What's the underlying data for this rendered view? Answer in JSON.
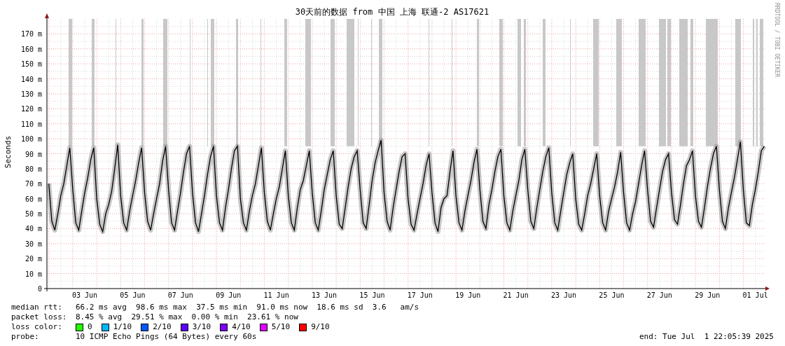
{
  "chart": {
    "title": "30天前的数据 from 中国 上海 联通-2 AS17621",
    "side_note": "RRDTOOL / TOBI OETIKER",
    "chart_data": {
      "type": "line",
      "ylabel": "Seconds",
      "ylim": [
        0,
        180
      ],
      "grid": true,
      "yticks": [
        {
          "value": 0,
          "label": "0"
        },
        {
          "value": 10,
          "label": "10 m"
        },
        {
          "value": 20,
          "label": "20 m"
        },
        {
          "value": 30,
          "label": "30 m"
        },
        {
          "value": 40,
          "label": "40 m"
        },
        {
          "value": 50,
          "label": "50 m"
        },
        {
          "value": 60,
          "label": "60 m"
        },
        {
          "value": 70,
          "label": "70 m"
        },
        {
          "value": 80,
          "label": "80 m"
        },
        {
          "value": 90,
          "label": "90 m"
        },
        {
          "value": 100,
          "label": "100 m"
        },
        {
          "value": 110,
          "label": "110 m"
        },
        {
          "value": 120,
          "label": "120 m"
        },
        {
          "value": 130,
          "label": "130 m"
        },
        {
          "value": 140,
          "label": "140 m"
        },
        {
          "value": 150,
          "label": "150 m"
        },
        {
          "value": 160,
          "label": "160 m"
        },
        {
          "value": 170,
          "label": "170 m"
        }
      ],
      "categories": [
        null,
        null,
        null,
        null,
        null,
        null,
        null,
        null,
        null,
        null,
        null,
        null,
        "03 Jun",
        null,
        null,
        null,
        null,
        null,
        null,
        null,
        null,
        null,
        null,
        null,
        null,
        null,
        null,
        null,
        "05 Jun",
        null,
        null,
        null,
        null,
        null,
        null,
        null,
        null,
        null,
        null,
        null,
        null,
        null,
        null,
        null,
        "07 Jun",
        null,
        null,
        null,
        null,
        null,
        null,
        null,
        null,
        null,
        null,
        null,
        null,
        null,
        null,
        null,
        "09 Jun",
        null,
        null,
        null,
        null,
        null,
        null,
        null,
        null,
        null,
        null,
        null,
        null,
        null,
        null,
        null,
        "11 Jun",
        null,
        null,
        null,
        null,
        null,
        null,
        null,
        null,
        null,
        null,
        null,
        null,
        null,
        null,
        null,
        "13 Jun",
        null,
        null,
        null,
        null,
        null,
        null,
        null,
        null,
        null,
        null,
        null,
        null,
        null,
        null,
        null,
        "15 Jun",
        null,
        null,
        null,
        null,
        null,
        null,
        null,
        null,
        null,
        null,
        null,
        null,
        null,
        null,
        null,
        "17 Jun",
        null,
        null,
        null,
        null,
        null,
        null,
        null,
        null,
        null,
        null,
        null,
        null,
        null,
        null,
        null,
        "19 Jun",
        null,
        null,
        null,
        null,
        null,
        null,
        null,
        null,
        null,
        null,
        null,
        null,
        null,
        null,
        null,
        "21 Jun",
        null,
        null,
        null,
        null,
        null,
        null,
        null,
        null,
        null,
        null,
        null,
        null,
        null,
        null,
        null,
        "23 Jun",
        null,
        null,
        null,
        null,
        null,
        null,
        null,
        null,
        null,
        null,
        null,
        null,
        null,
        null,
        null,
        "25 Jun",
        null,
        null,
        null,
        null,
        null,
        null,
        null,
        null,
        null,
        null,
        null,
        null,
        null,
        null,
        null,
        "27 Jun",
        null,
        null,
        null,
        null,
        null,
        null,
        null,
        null,
        null,
        null,
        null,
        null,
        null,
        null,
        null,
        "29 Jun",
        null,
        null,
        null,
        null,
        null,
        null,
        null,
        null,
        null,
        null,
        null,
        null,
        null,
        null,
        null,
        "01 Jul",
        null,
        null,
        null
      ],
      "series": [
        {
          "color": "#000000",
          "values": [
            70,
            45,
            39,
            50,
            62,
            70,
            82,
            94,
            66,
            44,
            39,
            52,
            64,
            74,
            86,
            94,
            60,
            43,
            38,
            50,
            56,
            65,
            80,
            96,
            62,
            44,
            39,
            52,
            62,
            72,
            84,
            94,
            64,
            45,
            39,
            50,
            60,
            70,
            85,
            95,
            66,
            44,
            39,
            52,
            64,
            78,
            90,
            95,
            64,
            44,
            38,
            50,
            62,
            76,
            88,
            95,
            62,
            44,
            39,
            54,
            66,
            80,
            92,
            95,
            60,
            44,
            39,
            52,
            62,
            70,
            82,
            94,
            64,
            45,
            39,
            50,
            60,
            68,
            80,
            92,
            62,
            44,
            39,
            54,
            66,
            72,
            82,
            92,
            64,
            44,
            39,
            52,
            66,
            76,
            86,
            92,
            62,
            43,
            40,
            54,
            68,
            80,
            88,
            92,
            66,
            44,
            40,
            56,
            72,
            84,
            92,
            99,
            64,
            45,
            39,
            54,
            66,
            78,
            88,
            90,
            60,
            43,
            39,
            50,
            60,
            70,
            82,
            90,
            64,
            44,
            38,
            54,
            60,
            62,
            78,
            92,
            62,
            44,
            39,
            52,
            62,
            72,
            84,
            93,
            66,
            45,
            40,
            56,
            66,
            78,
            88,
            93,
            62,
            44,
            39,
            52,
            62,
            72,
            86,
            93,
            66,
            45,
            40,
            54,
            66,
            78,
            88,
            94,
            64,
            44,
            39,
            52,
            64,
            76,
            84,
            90,
            60,
            43,
            39,
            50,
            62,
            70,
            80,
            90,
            62,
            44,
            39,
            52,
            60,
            68,
            78,
            91,
            64,
            44,
            39,
            50,
            58,
            70,
            82,
            92,
            66,
            45,
            41,
            54,
            66,
            78,
            86,
            90,
            64,
            46,
            43,
            56,
            70,
            82,
            86,
            92,
            62,
            45,
            41,
            54,
            68,
            80,
            90,
            95,
            66,
            45,
            40,
            54,
            64,
            74,
            86,
            98,
            66,
            44,
            42,
            56,
            66,
            78,
            92,
            95
          ]
        }
      ]
    }
  },
  "legend": {
    "median_rtt": {
      "label": "median rtt:",
      "text": "66.2 ms avg  98.6 ms max  37.5 ms min  91.0 ms now  18.6 ms sd  3.6   am/s"
    },
    "packet_loss": {
      "label": "packet loss:",
      "text": "8.45 % avg  29.51 % max  0.00 % min  23.61 % now"
    },
    "loss_color": {
      "label": "loss color:",
      "items": [
        {
          "label": "0",
          "color": "#26ff00"
        },
        {
          "label": "1/10",
          "color": "#00b8ff"
        },
        {
          "label": "2/10",
          "color": "#0059ff"
        },
        {
          "label": "3/10",
          "color": "#5e00ff"
        },
        {
          "label": "4/10",
          "color": "#7e00ff"
        },
        {
          "label": "5/10",
          "color": "#dd00ff"
        },
        {
          "label": "9/10",
          "color": "#ff0000"
        }
      ]
    },
    "probe": {
      "label": "probe:",
      "text": "10 ICMP Echo Pings (64 Bytes) every 60s"
    },
    "end": "end: Tue Jul  1 22:05:39 2025"
  }
}
